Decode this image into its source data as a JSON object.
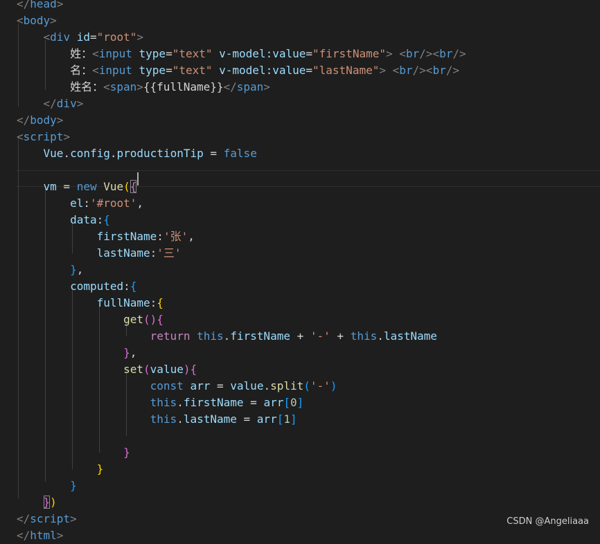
{
  "watermark": "CSDN @Angeliaaa",
  "lines": [
    [
      {
        "t": "</",
        "c": "t-punct"
      },
      {
        "t": "head",
        "c": "t-tag"
      },
      {
        "t": ">",
        "c": "t-punct"
      }
    ],
    [
      {
        "t": "<",
        "c": "t-punct"
      },
      {
        "t": "body",
        "c": "t-tag"
      },
      {
        "t": ">",
        "c": "t-punct"
      }
    ],
    [
      {
        "t": "    "
      },
      {
        "t": "<",
        "c": "t-punct"
      },
      {
        "t": "div",
        "c": "t-tag"
      },
      {
        "t": " "
      },
      {
        "t": "id",
        "c": "t-attr"
      },
      {
        "t": "=",
        "c": "t-text"
      },
      {
        "t": "\"root\"",
        "c": "t-str"
      },
      {
        "t": ">",
        "c": "t-punct"
      }
    ],
    [
      {
        "t": "        "
      },
      {
        "t": "姓：",
        "c": "t-text"
      },
      {
        "t": "<",
        "c": "t-punct"
      },
      {
        "t": "input",
        "c": "t-tag"
      },
      {
        "t": " "
      },
      {
        "t": "type",
        "c": "t-attr"
      },
      {
        "t": "=",
        "c": "t-text"
      },
      {
        "t": "\"text\"",
        "c": "t-str"
      },
      {
        "t": " "
      },
      {
        "t": "v-model:value",
        "c": "t-attr"
      },
      {
        "t": "=",
        "c": "t-text"
      },
      {
        "t": "\"firstName\"",
        "c": "t-str"
      },
      {
        "t": ">",
        "c": "t-punct"
      },
      {
        "t": " "
      },
      {
        "t": "<",
        "c": "t-punct"
      },
      {
        "t": "br",
        "c": "t-tag"
      },
      {
        "t": "/><",
        "c": "t-punct"
      },
      {
        "t": "br",
        "c": "t-tag"
      },
      {
        "t": "/>",
        "c": "t-punct"
      }
    ],
    [
      {
        "t": "        "
      },
      {
        "t": "名：",
        "c": "t-text"
      },
      {
        "t": "<",
        "c": "t-punct"
      },
      {
        "t": "input",
        "c": "t-tag"
      },
      {
        "t": " "
      },
      {
        "t": "type",
        "c": "t-attr"
      },
      {
        "t": "=",
        "c": "t-text"
      },
      {
        "t": "\"text\"",
        "c": "t-str"
      },
      {
        "t": " "
      },
      {
        "t": "v-model:value",
        "c": "t-attr"
      },
      {
        "t": "=",
        "c": "t-text"
      },
      {
        "t": "\"lastName\"",
        "c": "t-str"
      },
      {
        "t": ">",
        "c": "t-punct"
      },
      {
        "t": " "
      },
      {
        "t": "<",
        "c": "t-punct"
      },
      {
        "t": "br",
        "c": "t-tag"
      },
      {
        "t": "/><",
        "c": "t-punct"
      },
      {
        "t": "br",
        "c": "t-tag"
      },
      {
        "t": "/>",
        "c": "t-punct"
      }
    ],
    [
      {
        "t": "        "
      },
      {
        "t": "姓名：",
        "c": "t-text"
      },
      {
        "t": "<",
        "c": "t-punct"
      },
      {
        "t": "span",
        "c": "t-tag"
      },
      {
        "t": ">",
        "c": "t-punct"
      },
      {
        "t": "{{fullName}}",
        "c": "t-text"
      },
      {
        "t": "</",
        "c": "t-punct"
      },
      {
        "t": "span",
        "c": "t-tag"
      },
      {
        "t": ">",
        "c": "t-punct"
      }
    ],
    [
      {
        "t": "    "
      },
      {
        "t": "</",
        "c": "t-punct"
      },
      {
        "t": "div",
        "c": "t-tag"
      },
      {
        "t": ">",
        "c": "t-punct"
      }
    ],
    [
      {
        "t": "</",
        "c": "t-punct"
      },
      {
        "t": "body",
        "c": "t-tag"
      },
      {
        "t": ">",
        "c": "t-punct"
      }
    ],
    [
      {
        "t": "<",
        "c": "t-punct"
      },
      {
        "t": "script",
        "c": "t-tag"
      },
      {
        "t": ">",
        "c": "t-punct"
      }
    ],
    [
      {
        "t": "    "
      },
      {
        "t": "Vue",
        "c": "t-var"
      },
      {
        "t": ".",
        "c": "t-text"
      },
      {
        "t": "config",
        "c": "t-var"
      },
      {
        "t": ".",
        "c": "t-text"
      },
      {
        "t": "productionTip",
        "c": "t-var"
      },
      {
        "t": " = ",
        "c": "t-text"
      },
      {
        "t": "false",
        "c": "t-kw"
      }
    ],
    [
      {
        "t": ""
      }
    ],
    [
      {
        "t": "    "
      },
      {
        "t": "vm",
        "c": "t-var"
      },
      {
        "t": " = ",
        "c": "t-text"
      },
      {
        "t": "new",
        "c": "t-kw"
      },
      {
        "t": " "
      },
      {
        "t": "Vue",
        "c": "t-fn"
      },
      {
        "t": "(",
        "c": "t-b1"
      },
      {
        "t": "{",
        "c": "t-b2 t-hl"
      }
    ],
    [
      {
        "t": "        "
      },
      {
        "t": "el",
        "c": "t-var"
      },
      {
        "t": ":",
        "c": "t-text"
      },
      {
        "t": "'#root'",
        "c": "t-str"
      },
      {
        "t": ",",
        "c": "t-text"
      }
    ],
    [
      {
        "t": "        "
      },
      {
        "t": "data",
        "c": "t-var"
      },
      {
        "t": ":",
        "c": "t-text"
      },
      {
        "t": "{",
        "c": "t-b3"
      }
    ],
    [
      {
        "t": "            "
      },
      {
        "t": "firstName",
        "c": "t-var"
      },
      {
        "t": ":",
        "c": "t-text"
      },
      {
        "t": "'张'",
        "c": "t-str"
      },
      {
        "t": ",",
        "c": "t-text"
      }
    ],
    [
      {
        "t": "            "
      },
      {
        "t": "lastName",
        "c": "t-var"
      },
      {
        "t": ":",
        "c": "t-text"
      },
      {
        "t": "'三'",
        "c": "t-str"
      }
    ],
    [
      {
        "t": "        "
      },
      {
        "t": "}",
        "c": "t-b3"
      },
      {
        "t": ",",
        "c": "t-text"
      }
    ],
    [
      {
        "t": "        "
      },
      {
        "t": "computed",
        "c": "t-var"
      },
      {
        "t": ":",
        "c": "t-text"
      },
      {
        "t": "{",
        "c": "t-b3"
      }
    ],
    [
      {
        "t": "            "
      },
      {
        "t": "fullName",
        "c": "t-var"
      },
      {
        "t": ":",
        "c": "t-text"
      },
      {
        "t": "{",
        "c": "t-b1"
      }
    ],
    [
      {
        "t": "                "
      },
      {
        "t": "get",
        "c": "t-fn"
      },
      {
        "t": "()",
        "c": "t-b2"
      },
      {
        "t": "{",
        "c": "t-b2"
      }
    ],
    [
      {
        "t": "                    "
      },
      {
        "t": "return",
        "c": "t-ctrl"
      },
      {
        "t": " "
      },
      {
        "t": "this",
        "c": "t-kw"
      },
      {
        "t": ".",
        "c": "t-text"
      },
      {
        "t": "firstName",
        "c": "t-var"
      },
      {
        "t": " + ",
        "c": "t-text"
      },
      {
        "t": "'-'",
        "c": "t-str"
      },
      {
        "t": " + ",
        "c": "t-text"
      },
      {
        "t": "this",
        "c": "t-kw"
      },
      {
        "t": ".",
        "c": "t-text"
      },
      {
        "t": "lastName",
        "c": "t-var"
      }
    ],
    [
      {
        "t": "                "
      },
      {
        "t": "}",
        "c": "t-b2"
      },
      {
        "t": ",",
        "c": "t-text"
      }
    ],
    [
      {
        "t": "                "
      },
      {
        "t": "set",
        "c": "t-fn"
      },
      {
        "t": "(",
        "c": "t-b2"
      },
      {
        "t": "value",
        "c": "t-var"
      },
      {
        "t": ")",
        "c": "t-b2"
      },
      {
        "t": "{",
        "c": "t-b2"
      }
    ],
    [
      {
        "t": "                    "
      },
      {
        "t": "const",
        "c": "t-kw"
      },
      {
        "t": " "
      },
      {
        "t": "arr",
        "c": "t-var"
      },
      {
        "t": " = ",
        "c": "t-text"
      },
      {
        "t": "value",
        "c": "t-var"
      },
      {
        "t": ".",
        "c": "t-text"
      },
      {
        "t": "split",
        "c": "t-fn"
      },
      {
        "t": "(",
        "c": "t-b3"
      },
      {
        "t": "'-'",
        "c": "t-str"
      },
      {
        "t": ")",
        "c": "t-b3"
      }
    ],
    [
      {
        "t": "                    "
      },
      {
        "t": "this",
        "c": "t-kw"
      },
      {
        "t": ".",
        "c": "t-text"
      },
      {
        "t": "firstName",
        "c": "t-var"
      },
      {
        "t": " = ",
        "c": "t-text"
      },
      {
        "t": "arr",
        "c": "t-var"
      },
      {
        "t": "[",
        "c": "t-b3"
      },
      {
        "t": "0",
        "c": "t-num"
      },
      {
        "t": "]",
        "c": "t-b3"
      }
    ],
    [
      {
        "t": "                    "
      },
      {
        "t": "this",
        "c": "t-kw"
      },
      {
        "t": ".",
        "c": "t-text"
      },
      {
        "t": "lastName",
        "c": "t-var"
      },
      {
        "t": " = ",
        "c": "t-text"
      },
      {
        "t": "arr",
        "c": "t-var"
      },
      {
        "t": "[",
        "c": "t-b3"
      },
      {
        "t": "1",
        "c": "t-num"
      },
      {
        "t": "]",
        "c": "t-b3"
      }
    ],
    [
      {
        "t": ""
      }
    ],
    [
      {
        "t": "                "
      },
      {
        "t": "}",
        "c": "t-b2"
      }
    ],
    [
      {
        "t": "            "
      },
      {
        "t": "}",
        "c": "t-b1"
      }
    ],
    [
      {
        "t": "        "
      },
      {
        "t": "}",
        "c": "t-b3"
      }
    ],
    [
      {
        "t": "    "
      },
      {
        "t": "}",
        "c": "t-b2 t-hl"
      },
      {
        "t": ")",
        "c": "t-b1"
      }
    ],
    [
      {
        "t": "</",
        "c": "t-punct"
      },
      {
        "t": "script",
        "c": "t-tag"
      },
      {
        "t": ">",
        "c": "t-punct"
      }
    ],
    [
      {
        "t": "</",
        "c": "t-punct"
      },
      {
        "t": "html",
        "c": "t-tag"
      },
      {
        "t": ">",
        "c": "t-punct"
      }
    ]
  ]
}
